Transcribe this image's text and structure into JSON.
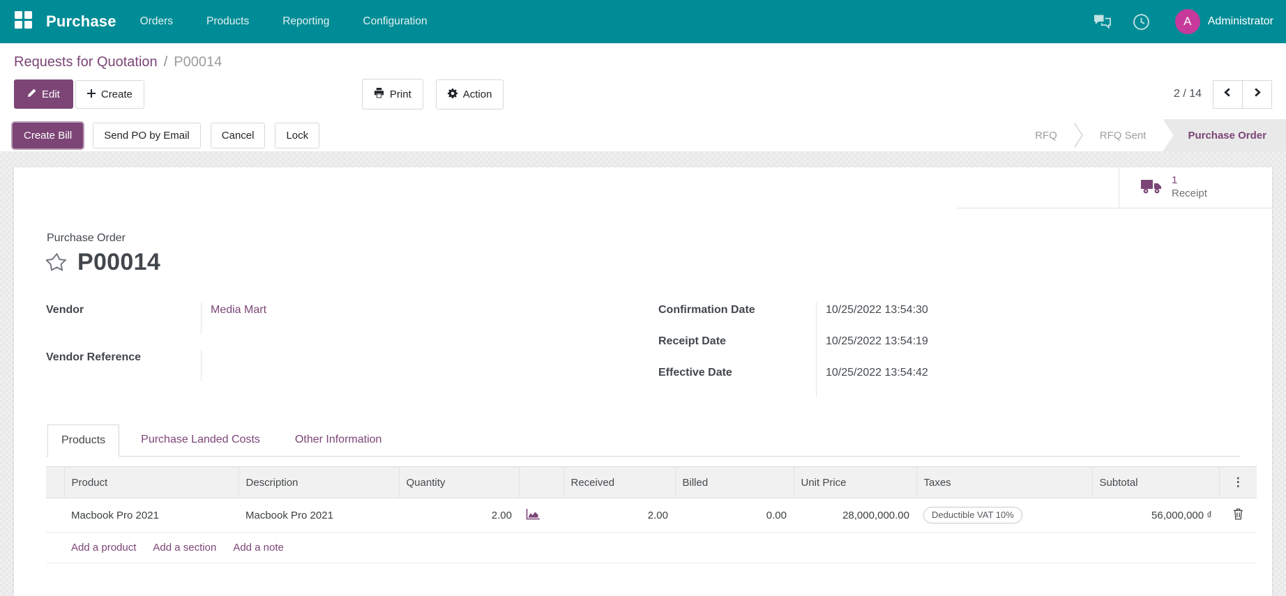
{
  "colors": {
    "topbar_bg": "#008c96",
    "accent_purple": "#7c4576",
    "avatar_bg": "#c7399b",
    "active_step_bg": "#e9e9e9",
    "muted_text": "#9a9da0"
  },
  "topbar": {
    "brand": "Purchase",
    "menus": [
      "Orders",
      "Products",
      "Reporting",
      "Configuration"
    ],
    "user": {
      "initial": "A",
      "name": "Administrator"
    }
  },
  "breadcrumb": {
    "parent": "Requests for Quotation",
    "separator": "/",
    "current": "P00014"
  },
  "controls": {
    "edit": "Edit",
    "create": "Create",
    "print": "Print",
    "action": "Action",
    "pager_count": "2 / 14"
  },
  "statusbar": {
    "buttons": [
      "Create Bill",
      "Send PO by Email",
      "Cancel",
      "Lock"
    ],
    "steps": [
      {
        "label": "RFQ",
        "active": false
      },
      {
        "label": "RFQ Sent",
        "active": false
      },
      {
        "label": "Purchase Order",
        "active": true
      }
    ]
  },
  "smart_button": {
    "count": "1",
    "label": "Receipt"
  },
  "document": {
    "type_label": "Purchase Order",
    "name": "P00014"
  },
  "fields": {
    "left": [
      {
        "label": "Vendor",
        "value": "Media Mart"
      },
      {
        "label": "Vendor Reference",
        "value": ""
      }
    ],
    "right": [
      {
        "label": "Confirmation Date",
        "value": "10/25/2022 13:54:30"
      },
      {
        "label": "Receipt Date",
        "value": "10/25/2022 13:54:19"
      },
      {
        "label": "Effective Date",
        "value": "10/25/2022 13:54:42"
      }
    ]
  },
  "tabs": [
    {
      "label": "Products",
      "active": true
    },
    {
      "label": "Purchase Landed Costs",
      "active": false
    },
    {
      "label": "Other Information",
      "active": false
    }
  ],
  "table": {
    "headers": [
      "",
      "Product",
      "Description",
      "Quantity",
      "",
      "Received",
      "Billed",
      "Unit Price",
      "Taxes",
      "Subtotal"
    ],
    "options_icon": "⋮",
    "row": {
      "product": "Macbook Pro 2021",
      "description": "Macbook Pro 2021",
      "quantity": "2.00",
      "received": "2.00",
      "billed": "0.00",
      "unit_price": "28,000,000.00",
      "tax": "Deductible VAT 10%",
      "subtotal": "56,000,000 ₫"
    },
    "add_links": [
      "Add a product",
      "Add a section",
      "Add a note"
    ]
  }
}
